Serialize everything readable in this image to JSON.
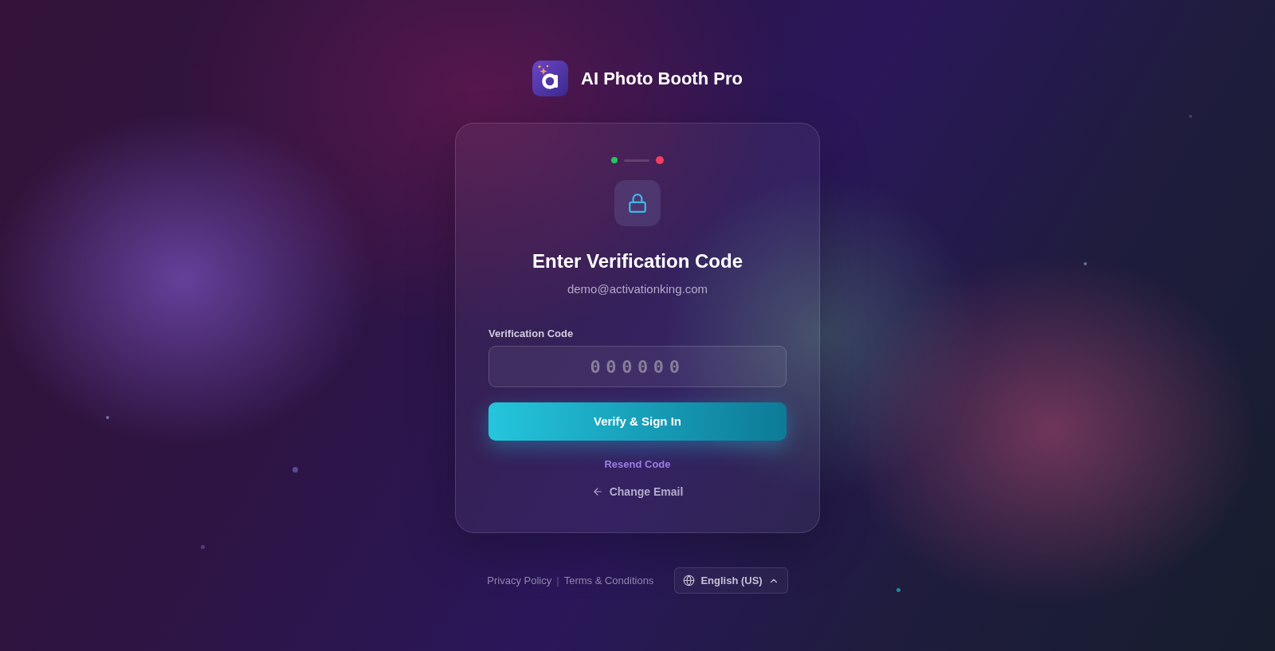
{
  "header": {
    "title": "AI Photo Booth Pro"
  },
  "card": {
    "steps": [
      {
        "color": "#22c55e"
      },
      {
        "color": "#f43f5e"
      }
    ],
    "heading": "Enter Verification Code",
    "email": "demo@activationking.com",
    "field": {
      "label": "Verification Code",
      "placeholder": "000000"
    },
    "submit_button": "Verify & Sign In",
    "resend_link": "Resend Code",
    "back_link": "Change Email"
  },
  "footer": {
    "links": [
      "Privacy Policy",
      "Terms & Conditions"
    ],
    "separator": "|",
    "language": {
      "label": "English (US)"
    }
  }
}
